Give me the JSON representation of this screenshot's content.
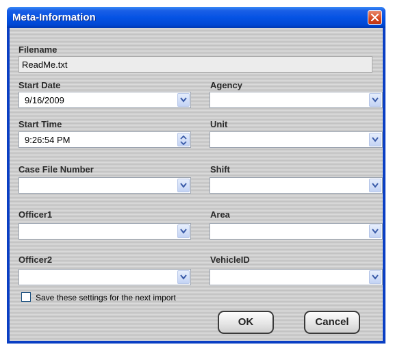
{
  "window": {
    "title": "Meta-Information"
  },
  "fields": {
    "filename": {
      "label": "Filename",
      "value": "ReadMe.txt"
    },
    "start_date": {
      "label": "Start Date",
      "value": "9/16/2009"
    },
    "agency": {
      "label": "Agency",
      "value": ""
    },
    "start_time": {
      "label": "Start Time",
      "value": "9:26:54 PM"
    },
    "unit": {
      "label": "Unit",
      "value": ""
    },
    "case_file_number": {
      "label": "Case File Number",
      "value": ""
    },
    "shift": {
      "label": "Shift",
      "value": ""
    },
    "officer1": {
      "label": "Officer1",
      "value": ""
    },
    "area": {
      "label": "Area",
      "value": ""
    },
    "officer2": {
      "label": "Officer2",
      "value": ""
    },
    "vehicle_id": {
      "label": "VehicleID",
      "value": ""
    }
  },
  "save_settings": {
    "label": "Save these settings for the next import",
    "checked": false
  },
  "buttons": {
    "ok": "OK",
    "cancel": "Cancel"
  }
}
